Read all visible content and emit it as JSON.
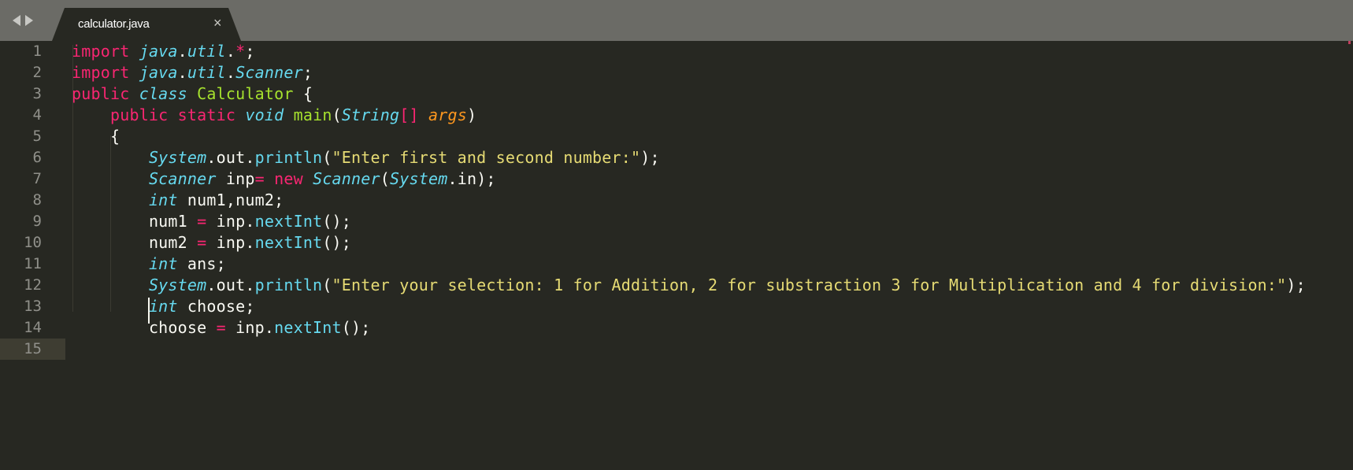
{
  "tab": {
    "title": "calculator.java",
    "close_glyph": "×"
  },
  "editor": {
    "active_line": 15,
    "lines": [
      {
        "num": "1",
        "indent": "",
        "tokens": [
          {
            "t": "import",
            "c": "kw"
          },
          {
            "t": " ",
            "c": ""
          },
          {
            "t": "java",
            "c": "it"
          },
          {
            "t": ".",
            "c": ""
          },
          {
            "t": "util",
            "c": "it"
          },
          {
            "t": ".",
            "c": ""
          },
          {
            "t": "*",
            "c": "op"
          },
          {
            "t": ";",
            "c": ""
          }
        ]
      },
      {
        "num": "2",
        "indent": "",
        "tokens": [
          {
            "t": "import",
            "c": "kw"
          },
          {
            "t": " ",
            "c": ""
          },
          {
            "t": "java",
            "c": "it"
          },
          {
            "t": ".",
            "c": ""
          },
          {
            "t": "util",
            "c": "it"
          },
          {
            "t": ".",
            "c": ""
          },
          {
            "t": "Scanner",
            "c": "it"
          },
          {
            "t": ";",
            "c": ""
          }
        ]
      },
      {
        "num": "3",
        "indent": "",
        "tokens": [
          {
            "t": "public",
            "c": "kw"
          },
          {
            "t": " ",
            "c": ""
          },
          {
            "t": "class",
            "c": "it"
          },
          {
            "t": " ",
            "c": ""
          },
          {
            "t": "Calculator",
            "c": "cls"
          },
          {
            "t": " {",
            "c": ""
          }
        ]
      },
      {
        "num": "4",
        "indent": "    ",
        "tokens": [
          {
            "t": "public",
            "c": "kw"
          },
          {
            "t": " ",
            "c": ""
          },
          {
            "t": "static",
            "c": "kw"
          },
          {
            "t": " ",
            "c": ""
          },
          {
            "t": "void",
            "c": "it"
          },
          {
            "t": " ",
            "c": ""
          },
          {
            "t": "main",
            "c": "fname"
          },
          {
            "t": "(",
            "c": ""
          },
          {
            "t": "String",
            "c": "it"
          },
          {
            "t": "[]",
            "c": "op"
          },
          {
            "t": " ",
            "c": ""
          },
          {
            "t": "args",
            "c": "param"
          },
          {
            "t": ")",
            "c": ""
          }
        ]
      },
      {
        "num": "5",
        "indent": "    ",
        "tokens": [
          {
            "t": "{",
            "c": ""
          }
        ]
      },
      {
        "num": "6",
        "indent": "        ",
        "tokens": [
          {
            "t": "System",
            "c": "it"
          },
          {
            "t": ".out.",
            "c": ""
          },
          {
            "t": "println",
            "c": "fn"
          },
          {
            "t": "(",
            "c": ""
          },
          {
            "t": "\"Enter first and second number:\"",
            "c": "str"
          },
          {
            "t": ");",
            "c": ""
          }
        ]
      },
      {
        "num": "7",
        "indent": "        ",
        "tokens": [
          {
            "t": "Scanner",
            "c": "it"
          },
          {
            "t": " inp",
            "c": ""
          },
          {
            "t": "=",
            "c": "op"
          },
          {
            "t": " ",
            "c": ""
          },
          {
            "t": "new",
            "c": "kw"
          },
          {
            "t": " ",
            "c": ""
          },
          {
            "t": "Scanner",
            "c": "it"
          },
          {
            "t": "(",
            "c": ""
          },
          {
            "t": "System",
            "c": "it"
          },
          {
            "t": ".in);",
            "c": ""
          }
        ]
      },
      {
        "num": "8",
        "indent": "        ",
        "tokens": [
          {
            "t": "int",
            "c": "it"
          },
          {
            "t": " num1,num2;",
            "c": ""
          }
        ]
      },
      {
        "num": "9",
        "indent": "        ",
        "tokens": [
          {
            "t": "num1 ",
            "c": ""
          },
          {
            "t": "=",
            "c": "op"
          },
          {
            "t": " inp.",
            "c": ""
          },
          {
            "t": "nextInt",
            "c": "fn"
          },
          {
            "t": "();",
            "c": ""
          }
        ]
      },
      {
        "num": "10",
        "indent": "        ",
        "tokens": [
          {
            "t": "num2 ",
            "c": ""
          },
          {
            "t": "=",
            "c": "op"
          },
          {
            "t": " inp.",
            "c": ""
          },
          {
            "t": "nextInt",
            "c": "fn"
          },
          {
            "t": "();",
            "c": ""
          }
        ]
      },
      {
        "num": "11",
        "indent": "        ",
        "tokens": [
          {
            "t": "int",
            "c": "it"
          },
          {
            "t": " ans;",
            "c": ""
          }
        ]
      },
      {
        "num": "12",
        "indent": "        ",
        "tokens": [
          {
            "t": "System",
            "c": "it"
          },
          {
            "t": ".out.",
            "c": ""
          },
          {
            "t": "println",
            "c": "fn"
          },
          {
            "t": "(",
            "c": ""
          },
          {
            "t": "\"Enter your selection: 1 for Addition, 2 for substraction 3 for Multiplication and 4 for division:\"",
            "c": "str"
          },
          {
            "t": ");",
            "c": ""
          }
        ]
      },
      {
        "num": "13",
        "indent": "        ",
        "tokens": [
          {
            "t": "int",
            "c": "it"
          },
          {
            "t": " choose;",
            "c": ""
          }
        ]
      },
      {
        "num": "14",
        "indent": "        ",
        "tokens": [
          {
            "t": "choose ",
            "c": ""
          },
          {
            "t": "=",
            "c": "op"
          },
          {
            "t": " inp.",
            "c": ""
          },
          {
            "t": "nextInt",
            "c": "fn"
          },
          {
            "t": "();",
            "c": ""
          }
        ]
      },
      {
        "num": "15",
        "indent": "        ",
        "tokens": []
      }
    ]
  },
  "colors": {
    "background": "#272822",
    "tabbar": "#6b6b66",
    "keyword": "#f92672",
    "type_italic": "#66d9ef",
    "class_name": "#a6e22e",
    "string": "#e6db74",
    "parameter": "#fd971f",
    "line_number": "#90908a"
  }
}
